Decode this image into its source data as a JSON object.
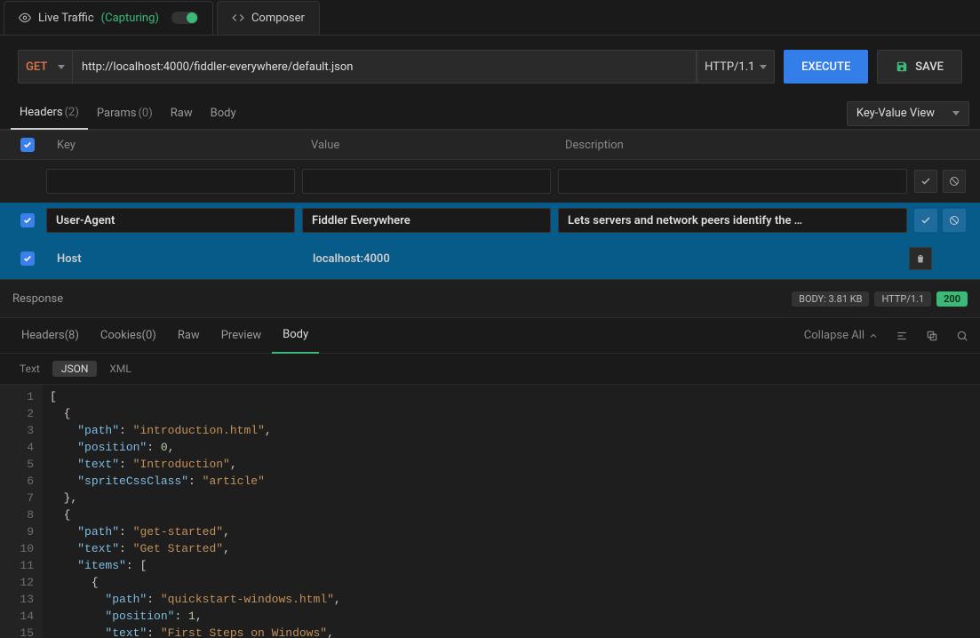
{
  "topTabs": {
    "live": {
      "label": "Live Traffic",
      "status": "(Capturing)"
    },
    "composer": {
      "label": "Composer"
    }
  },
  "request": {
    "method": "GET",
    "url": "http://localhost:4000/fiddler-everywhere/default.json",
    "httpVersion": "HTTP/1.1",
    "executeLabel": "EXECUTE",
    "saveLabel": "SAVE"
  },
  "reqTabs": {
    "headers": "Headers",
    "headersCount": "(2)",
    "params": "Params",
    "paramsCount": "(0)",
    "raw": "Raw",
    "body": "Body",
    "viewMode": "Key-Value View"
  },
  "headerCols": {
    "key": "Key",
    "value": "Value",
    "desc": "Description"
  },
  "headers": [
    {
      "key": "User-Agent",
      "value": "Fiddler Everywhere",
      "desc": "Lets servers and network peers identify the …"
    },
    {
      "key": "Host",
      "value": "localhost:4000"
    }
  ],
  "response": {
    "title": "Response",
    "bodySize": "BODY: 3.81 KB",
    "httpVersion": "HTTP/1.1",
    "status": "200",
    "tabs": {
      "headers": "Headers",
      "headersCount": "(8)",
      "cookies": "Cookies",
      "cookiesCount": "(0)",
      "raw": "Raw",
      "preview": "Preview",
      "body": "Body"
    },
    "collapse": "Collapse All",
    "bodyTypes": {
      "text": "Text",
      "json": "JSON",
      "xml": "XML"
    }
  },
  "code": [
    {
      "t": "[",
      "ind": 0
    },
    {
      "t": "{",
      "ind": 1
    },
    {
      "k": "\"path\"",
      "v": "\"introduction.html\"",
      "vt": "str",
      "comma": true,
      "ind": 2
    },
    {
      "k": "\"position\"",
      "v": "0",
      "vt": "num",
      "comma": true,
      "ind": 2
    },
    {
      "k": "\"text\"",
      "v": "\"Introduction\"",
      "vt": "str",
      "comma": true,
      "ind": 2
    },
    {
      "k": "\"spriteCssClass\"",
      "v": "\"article\"",
      "vt": "str",
      "comma": false,
      "ind": 2
    },
    {
      "t": "},",
      "ind": 1
    },
    {
      "t": "{",
      "ind": 1
    },
    {
      "k": "\"path\"",
      "v": "\"get-started\"",
      "vt": "str",
      "comma": true,
      "ind": 2
    },
    {
      "k": "\"text\"",
      "v": "\"Get Started\"",
      "vt": "str",
      "comma": true,
      "ind": 2
    },
    {
      "k": "\"items\"",
      "v": "[",
      "vt": "punc",
      "comma": false,
      "ind": 2
    },
    {
      "t": "{",
      "ind": 3
    },
    {
      "k": "\"path\"",
      "v": "\"quickstart-windows.html\"",
      "vt": "str",
      "comma": true,
      "ind": 4
    },
    {
      "k": "\"position\"",
      "v": "1",
      "vt": "num",
      "comma": true,
      "ind": 4
    },
    {
      "k": "\"text\"",
      "v": "\"First Steps on Windows\"",
      "vt": "str",
      "comma": true,
      "ind": 4
    }
  ]
}
